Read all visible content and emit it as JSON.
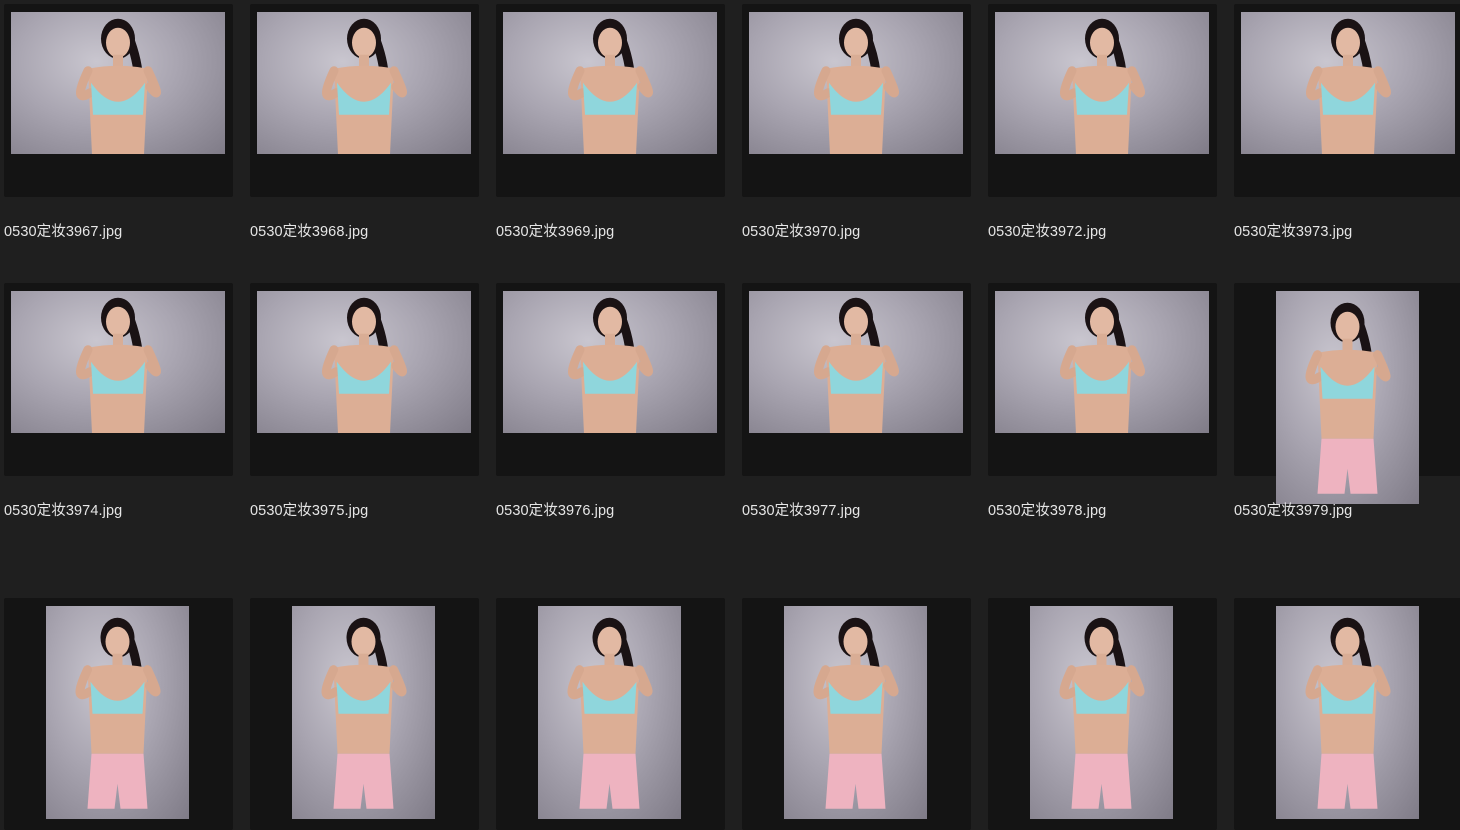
{
  "view": {
    "type": "thumbnail-grid",
    "accent": "#1f1f1f"
  },
  "items": [
    {
      "filename": "0530定妆3967.jpg",
      "orientation": "landscape"
    },
    {
      "filename": "0530定妆3968.jpg",
      "orientation": "landscape"
    },
    {
      "filename": "0530定妆3969.jpg",
      "orientation": "landscape"
    },
    {
      "filename": "0530定妆3970.jpg",
      "orientation": "landscape"
    },
    {
      "filename": "0530定妆3972.jpg",
      "orientation": "landscape"
    },
    {
      "filename": "0530定妆3973.jpg",
      "orientation": "landscape"
    },
    {
      "filename": "0530定妆3974.jpg",
      "orientation": "landscape"
    },
    {
      "filename": "0530定妆3975.jpg",
      "orientation": "landscape"
    },
    {
      "filename": "0530定妆3976.jpg",
      "orientation": "landscape"
    },
    {
      "filename": "0530定妆3977.jpg",
      "orientation": "landscape"
    },
    {
      "filename": "0530定妆3978.jpg",
      "orientation": "landscape"
    },
    {
      "filename": "0530定妆3979.jpg",
      "orientation": "portrait"
    },
    {
      "filename": "",
      "orientation": "portrait"
    },
    {
      "filename": "",
      "orientation": "portrait"
    },
    {
      "filename": "",
      "orientation": "portrait"
    },
    {
      "filename": "",
      "orientation": "portrait"
    },
    {
      "filename": "",
      "orientation": "portrait"
    },
    {
      "filename": "",
      "orientation": "portrait"
    }
  ]
}
